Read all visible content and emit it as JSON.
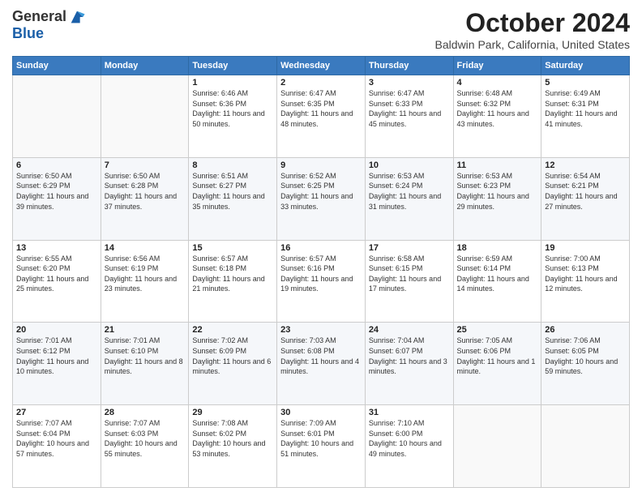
{
  "header": {
    "logo_line1": "General",
    "logo_line2": "Blue",
    "month": "October 2024",
    "location": "Baldwin Park, California, United States"
  },
  "weekdays": [
    "Sunday",
    "Monday",
    "Tuesday",
    "Wednesday",
    "Thursday",
    "Friday",
    "Saturday"
  ],
  "weeks": [
    [
      {
        "day": "",
        "content": ""
      },
      {
        "day": "",
        "content": ""
      },
      {
        "day": "1",
        "content": "Sunrise: 6:46 AM\nSunset: 6:36 PM\nDaylight: 11 hours and 50 minutes."
      },
      {
        "day": "2",
        "content": "Sunrise: 6:47 AM\nSunset: 6:35 PM\nDaylight: 11 hours and 48 minutes."
      },
      {
        "day": "3",
        "content": "Sunrise: 6:47 AM\nSunset: 6:33 PM\nDaylight: 11 hours and 45 minutes."
      },
      {
        "day": "4",
        "content": "Sunrise: 6:48 AM\nSunset: 6:32 PM\nDaylight: 11 hours and 43 minutes."
      },
      {
        "day": "5",
        "content": "Sunrise: 6:49 AM\nSunset: 6:31 PM\nDaylight: 11 hours and 41 minutes."
      }
    ],
    [
      {
        "day": "6",
        "content": "Sunrise: 6:50 AM\nSunset: 6:29 PM\nDaylight: 11 hours and 39 minutes."
      },
      {
        "day": "7",
        "content": "Sunrise: 6:50 AM\nSunset: 6:28 PM\nDaylight: 11 hours and 37 minutes."
      },
      {
        "day": "8",
        "content": "Sunrise: 6:51 AM\nSunset: 6:27 PM\nDaylight: 11 hours and 35 minutes."
      },
      {
        "day": "9",
        "content": "Sunrise: 6:52 AM\nSunset: 6:25 PM\nDaylight: 11 hours and 33 minutes."
      },
      {
        "day": "10",
        "content": "Sunrise: 6:53 AM\nSunset: 6:24 PM\nDaylight: 11 hours and 31 minutes."
      },
      {
        "day": "11",
        "content": "Sunrise: 6:53 AM\nSunset: 6:23 PM\nDaylight: 11 hours and 29 minutes."
      },
      {
        "day": "12",
        "content": "Sunrise: 6:54 AM\nSunset: 6:21 PM\nDaylight: 11 hours and 27 minutes."
      }
    ],
    [
      {
        "day": "13",
        "content": "Sunrise: 6:55 AM\nSunset: 6:20 PM\nDaylight: 11 hours and 25 minutes."
      },
      {
        "day": "14",
        "content": "Sunrise: 6:56 AM\nSunset: 6:19 PM\nDaylight: 11 hours and 23 minutes."
      },
      {
        "day": "15",
        "content": "Sunrise: 6:57 AM\nSunset: 6:18 PM\nDaylight: 11 hours and 21 minutes."
      },
      {
        "day": "16",
        "content": "Sunrise: 6:57 AM\nSunset: 6:16 PM\nDaylight: 11 hours and 19 minutes."
      },
      {
        "day": "17",
        "content": "Sunrise: 6:58 AM\nSunset: 6:15 PM\nDaylight: 11 hours and 17 minutes."
      },
      {
        "day": "18",
        "content": "Sunrise: 6:59 AM\nSunset: 6:14 PM\nDaylight: 11 hours and 14 minutes."
      },
      {
        "day": "19",
        "content": "Sunrise: 7:00 AM\nSunset: 6:13 PM\nDaylight: 11 hours and 12 minutes."
      }
    ],
    [
      {
        "day": "20",
        "content": "Sunrise: 7:01 AM\nSunset: 6:12 PM\nDaylight: 11 hours and 10 minutes."
      },
      {
        "day": "21",
        "content": "Sunrise: 7:01 AM\nSunset: 6:10 PM\nDaylight: 11 hours and 8 minutes."
      },
      {
        "day": "22",
        "content": "Sunrise: 7:02 AM\nSunset: 6:09 PM\nDaylight: 11 hours and 6 minutes."
      },
      {
        "day": "23",
        "content": "Sunrise: 7:03 AM\nSunset: 6:08 PM\nDaylight: 11 hours and 4 minutes."
      },
      {
        "day": "24",
        "content": "Sunrise: 7:04 AM\nSunset: 6:07 PM\nDaylight: 11 hours and 3 minutes."
      },
      {
        "day": "25",
        "content": "Sunrise: 7:05 AM\nSunset: 6:06 PM\nDaylight: 11 hours and 1 minute."
      },
      {
        "day": "26",
        "content": "Sunrise: 7:06 AM\nSunset: 6:05 PM\nDaylight: 10 hours and 59 minutes."
      }
    ],
    [
      {
        "day": "27",
        "content": "Sunrise: 7:07 AM\nSunset: 6:04 PM\nDaylight: 10 hours and 57 minutes."
      },
      {
        "day": "28",
        "content": "Sunrise: 7:07 AM\nSunset: 6:03 PM\nDaylight: 10 hours and 55 minutes."
      },
      {
        "day": "29",
        "content": "Sunrise: 7:08 AM\nSunset: 6:02 PM\nDaylight: 10 hours and 53 minutes."
      },
      {
        "day": "30",
        "content": "Sunrise: 7:09 AM\nSunset: 6:01 PM\nDaylight: 10 hours and 51 minutes."
      },
      {
        "day": "31",
        "content": "Sunrise: 7:10 AM\nSunset: 6:00 PM\nDaylight: 10 hours and 49 minutes."
      },
      {
        "day": "",
        "content": ""
      },
      {
        "day": "",
        "content": ""
      }
    ]
  ]
}
